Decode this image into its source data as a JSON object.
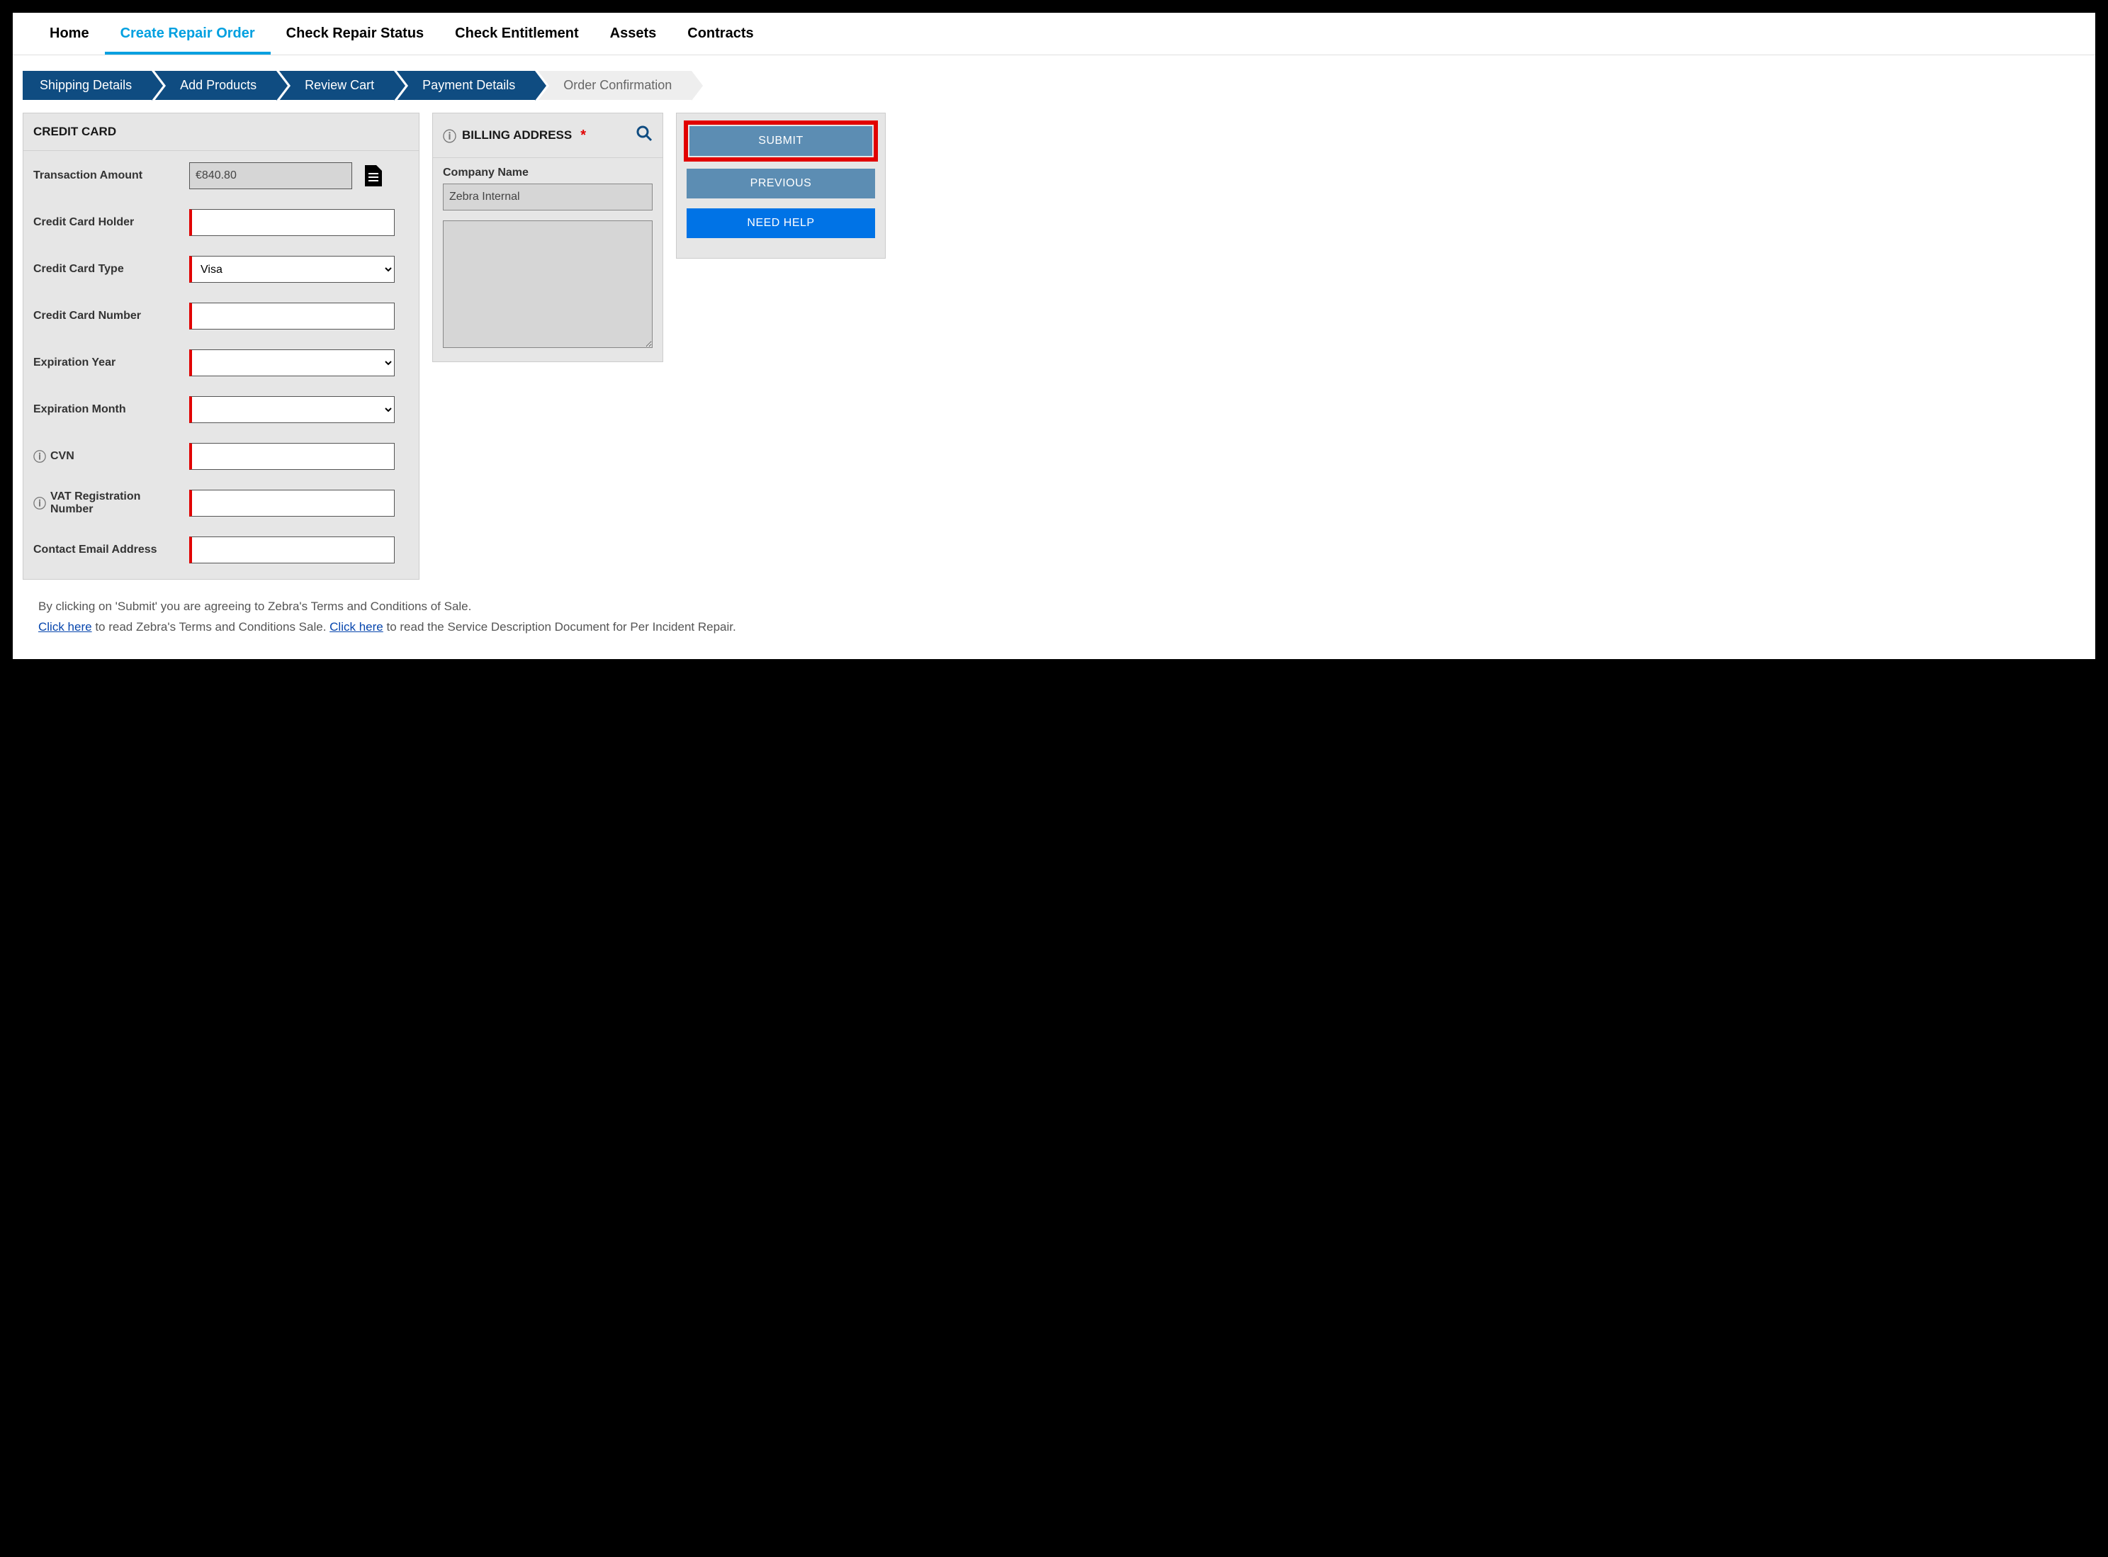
{
  "nav": {
    "items": [
      {
        "label": "Home",
        "active": false
      },
      {
        "label": "Create Repair Order",
        "active": true
      },
      {
        "label": "Check Repair Status",
        "active": false
      },
      {
        "label": "Check Entitlement",
        "active": false
      },
      {
        "label": "Assets",
        "active": false
      },
      {
        "label": "Contracts",
        "active": false
      }
    ]
  },
  "steps": [
    {
      "label": "Shipping Details",
      "active": true
    },
    {
      "label": "Add Products",
      "active": true
    },
    {
      "label": "Review Cart",
      "active": true
    },
    {
      "label": "Payment Details",
      "active": true
    },
    {
      "label": "Order Confirmation",
      "active": false
    }
  ],
  "credit_card": {
    "heading": "CREDIT CARD",
    "labels": {
      "transaction_amount": "Transaction Amount",
      "holder": "Credit Card Holder",
      "type": "Credit Card Type",
      "number": "Credit Card Number",
      "exp_year": "Expiration Year",
      "exp_month": "Expiration Month",
      "cvn": "CVN",
      "vat": "VAT Registration Number",
      "email": "Contact Email Address"
    },
    "values": {
      "transaction_amount": "€840.80",
      "holder": "",
      "type_selected": "Visa",
      "number": "",
      "exp_year": "",
      "exp_month": "",
      "cvn": "",
      "vat": "",
      "email": ""
    }
  },
  "billing": {
    "heading": "BILLING ADDRESS",
    "company_label": "Company Name",
    "company_value": "Zebra Internal",
    "address_value": ""
  },
  "actions": {
    "submit": "SUBMIT",
    "previous": "PREVIOUS",
    "need_help": "NEED HELP"
  },
  "terms": {
    "line1": "By clicking on 'Submit' you are agreeing to Zebra's Terms and Conditions of Sale.",
    "link1": "Click here",
    "mid1": " to read Zebra's Terms and Conditions Sale. ",
    "link2": "Click here",
    "mid2": " to read the Service Description Document for Per Incident Repair."
  }
}
